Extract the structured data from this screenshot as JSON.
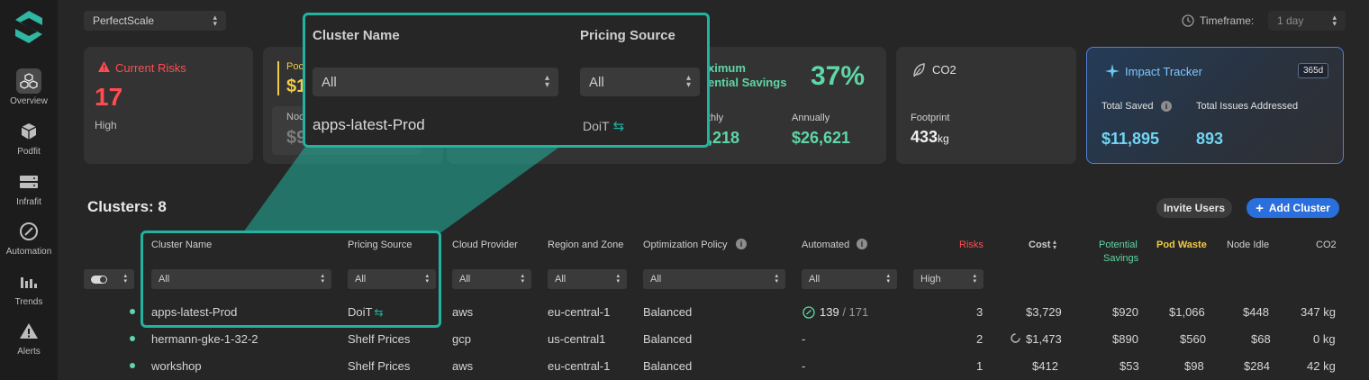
{
  "sidebar": {
    "items": [
      {
        "label": "Overview",
        "icon": "overview-icon",
        "active": true
      },
      {
        "label": "Podfit",
        "icon": "podfit-icon"
      },
      {
        "label": "Infrafit",
        "icon": "infrafit-icon"
      },
      {
        "label": "Automation",
        "icon": "automation-icon"
      },
      {
        "label": "Trends",
        "icon": "trends-icon"
      },
      {
        "label": "Alerts",
        "icon": "alerts-icon"
      }
    ]
  },
  "header": {
    "org_select": "PerfectScale",
    "timeframe_label": "Timeframe:",
    "timeframe_value": "1 day"
  },
  "cards": {
    "risks": {
      "title": "Current Risks",
      "value": "17",
      "sub": "High"
    },
    "pod": {
      "title": "Poc",
      "value": "$1",
      "node_label": "Noc",
      "node_value": "$9"
    },
    "savings": {
      "title_line1": "ximum",
      "title_line2": "ential Savings",
      "percent": "37%",
      "monthly_label": "thly",
      "monthly_value": ",218",
      "annually_label": "Annually",
      "annually_value": "$26,621"
    },
    "co2": {
      "title": "CO2",
      "footprint_label": "Footprint",
      "footprint_value": "433",
      "footprint_unit": "kg"
    },
    "impact": {
      "title": "Impact Tracker",
      "badge": "365d",
      "saved_label": "Total Saved",
      "saved_value": "$11,895",
      "issues_label": "Total Issues Addressed",
      "issues_value": "893"
    }
  },
  "clusters": {
    "title": "Clusters: 8",
    "invite_button": "Invite Users",
    "add_button": "Add Cluster",
    "columns": {
      "name": "Cluster Name",
      "pricing": "Pricing Source",
      "cloud": "Cloud Provider",
      "region": "Region and Zone",
      "policy": "Optimization Policy",
      "automated": "Automated",
      "risks": "Risks",
      "cost": "Cost",
      "savings_line1": "Potential",
      "savings_line2": "Savings",
      "waste": "Pod Waste",
      "idle": "Node Idle",
      "co2": "CO2"
    },
    "filters": {
      "name": "All",
      "pricing": "All",
      "cloud": "All",
      "region": "All",
      "policy": "All",
      "automated": "All",
      "risks": "High"
    },
    "rows": [
      {
        "name": "apps-latest-Prod",
        "pricing": "DoiT",
        "cloud": "aws",
        "region": "eu-central-1",
        "policy": "Balanced",
        "automated": "139",
        "automated_total": "/ 171",
        "risks": "3",
        "cost": "$3,729",
        "savings": "$920",
        "waste": "$1,066",
        "idle": "$448",
        "co2": "347 kg"
      },
      {
        "name": "hermann-gke-1-32-2",
        "pricing": "Shelf Prices",
        "cloud": "gcp",
        "region": "us-central1",
        "policy": "Balanced",
        "automated": "-",
        "risks": "2",
        "cost": "$1,473",
        "savings": "$890",
        "waste": "$560",
        "idle": "$68",
        "co2": "0 kg"
      },
      {
        "name": "workshop",
        "pricing": "Shelf Prices",
        "cloud": "aws",
        "region": "eu-central-1",
        "policy": "Balanced",
        "automated": "-",
        "risks": "1",
        "cost": "$412",
        "savings": "$53",
        "waste": "$98",
        "idle": "$284",
        "co2": "42 kg"
      }
    ]
  },
  "zoom": {
    "name_header": "Cluster Name",
    "pricing_header": "Pricing Source",
    "name_filter": "All",
    "pricing_filter": "All",
    "name_value": "apps-latest-Prod",
    "pricing_value": "DoiT"
  },
  "colors": {
    "accent": "#21b3a0",
    "green": "#5fd6a7",
    "red": "#ff4d4f",
    "yellow": "#f2cb45",
    "blue": "#2a6fdb"
  }
}
